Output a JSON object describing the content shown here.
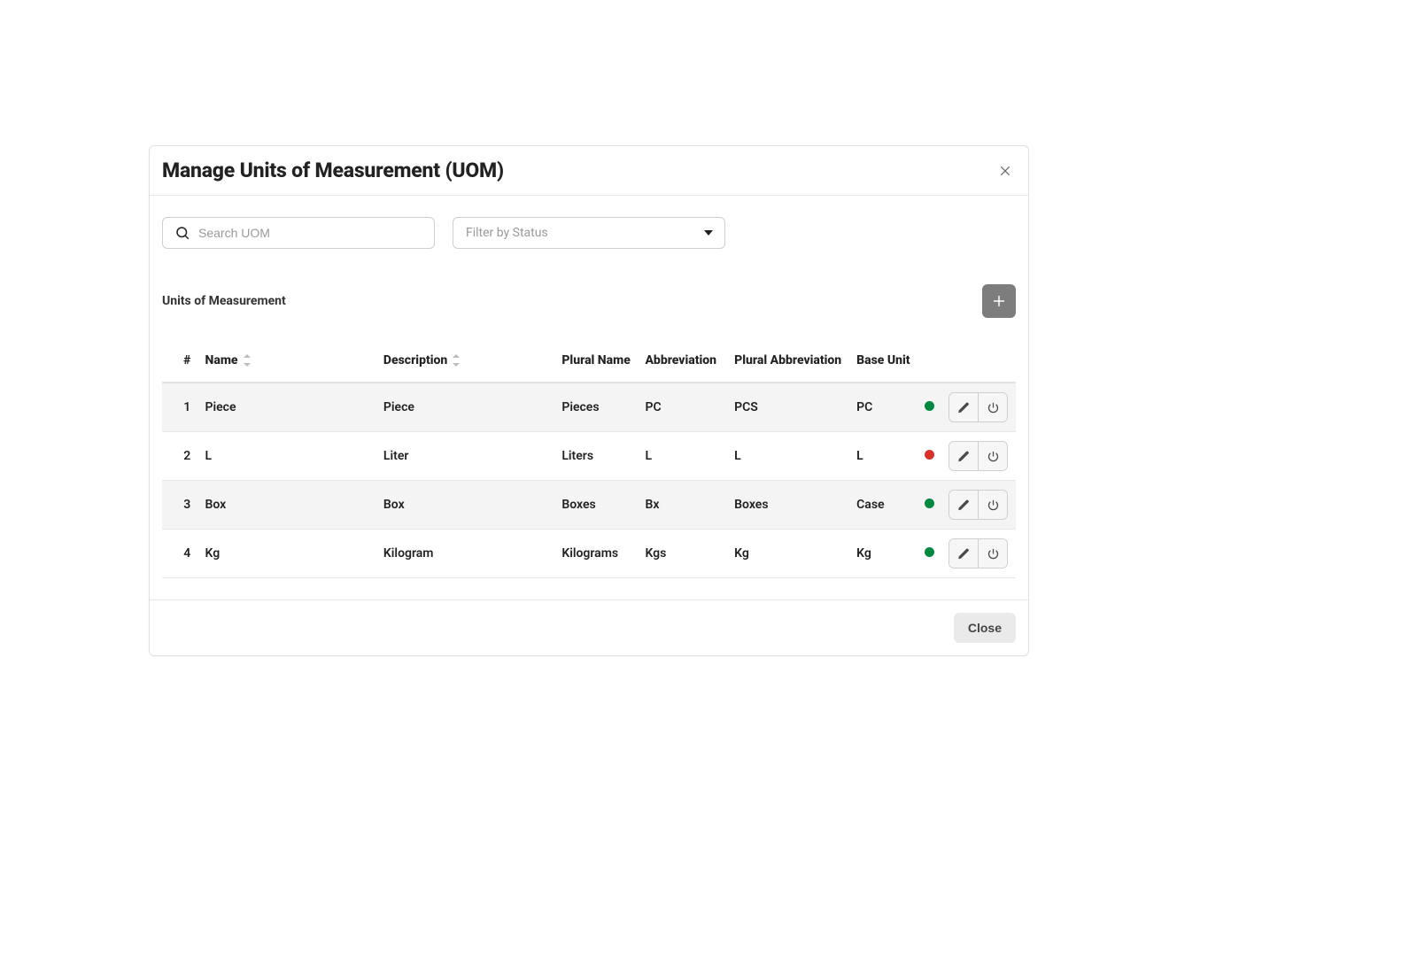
{
  "modal": {
    "title": "Manage Units of Measurement (UOM)",
    "close_label": "Close"
  },
  "search": {
    "placeholder": "Search UOM",
    "value": ""
  },
  "filter": {
    "placeholder": "Filter by Status"
  },
  "section": {
    "title": "Units of Measurement"
  },
  "table": {
    "headers": {
      "index": "#",
      "name": "Name",
      "description": "Description",
      "plural_name": "Plural Name",
      "abbreviation": "Abbreviation",
      "plural_abbreviation": "Plural Abbreviation",
      "base_unit": "Base Unit"
    },
    "rows": [
      {
        "index": "1",
        "name": "Piece",
        "description": "Piece",
        "plural_name": "Pieces",
        "abbreviation": "PC",
        "plural_abbreviation": "PCS",
        "base_unit": "PC",
        "status": "green"
      },
      {
        "index": "2",
        "name": "L",
        "description": "Liter",
        "plural_name": "Liters",
        "abbreviation": "L",
        "plural_abbreviation": "L",
        "base_unit": "L",
        "status": "red"
      },
      {
        "index": "3",
        "name": "Box",
        "description": "Box",
        "plural_name": "Boxes",
        "abbreviation": "Bx",
        "plural_abbreviation": "Boxes",
        "base_unit": "Case",
        "status": "green"
      },
      {
        "index": "4",
        "name": "Kg",
        "description": "Kilogram",
        "plural_name": "Kilograms",
        "abbreviation": "Kgs",
        "plural_abbreviation": "Kg",
        "base_unit": "Kg",
        "status": "green"
      }
    ]
  },
  "colors": {
    "status_green": "#008841",
    "status_red": "#d8312a",
    "add_button_bg": "#7d7d7d"
  }
}
